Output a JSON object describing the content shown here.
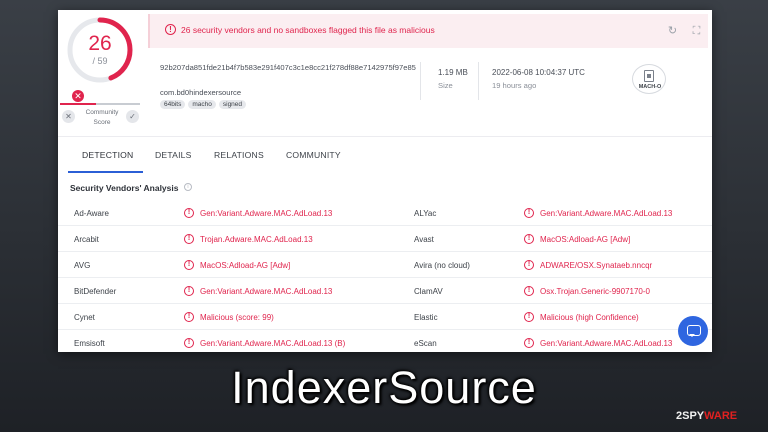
{
  "score": {
    "detected": "26",
    "total": "/ 59",
    "fraction": 0.44
  },
  "community": {
    "label_line1": "Community",
    "label_line2": "Score",
    "x_icon": "close-icon",
    "fill": 0.45
  },
  "alert": {
    "text": "26 security vendors and no sandboxes flagged this file as malicious",
    "color": "#e0244d"
  },
  "file": {
    "hash": "92b207da851fde21b4f7b583e291f407c3c1e8cc21f278df88e7142975f97e85",
    "name": "com.bd0hindexersource",
    "tags": [
      "64bits",
      "macho",
      "signed"
    ],
    "size": "1.19 MB",
    "size_label": "Size",
    "date": "2022-06-08 10:04:37 UTC",
    "date_ago": "19 hours ago",
    "type_label": "MACH-O"
  },
  "tabs": [
    "DETECTION",
    "DETAILS",
    "RELATIONS",
    "COMMUNITY"
  ],
  "section_title": "Security Vendors' Analysis",
  "vendors": [
    {
      "left_name": "Ad-Aware",
      "left_result": "Gen:Variant.Adware.MAC.AdLoad.13",
      "right_name": "ALYac",
      "right_result": "Gen:Variant.Adware.MAC.AdLoad.13"
    },
    {
      "left_name": "Arcabit",
      "left_result": "Trojan.Adware.MAC.AdLoad.13",
      "right_name": "Avast",
      "right_result": "MacOS:Adload-AG [Adw]"
    },
    {
      "left_name": "AVG",
      "left_result": "MacOS:Adload-AG [Adw]",
      "right_name": "Avira (no cloud)",
      "right_result": "ADWARE/OSX.Synataeb.nncqr"
    },
    {
      "left_name": "BitDefender",
      "left_result": "Gen:Variant.Adware.MAC.AdLoad.13",
      "right_name": "ClamAV",
      "right_result": "Osx.Trojan.Generic-9907170-0"
    },
    {
      "left_name": "Cynet",
      "left_result": "Malicious (score: 99)",
      "right_name": "Elastic",
      "right_result": "Malicious (high Confidence)"
    },
    {
      "left_name": "Emsisoft",
      "left_result": "Gen:Variant.Adware.MAC.AdLoad.13 (B)",
      "right_name": "eScan",
      "right_result": "Gen:Variant.Adware.MAC.AdLoad.13"
    }
  ],
  "caption": "IndexerSource",
  "watermark": {
    "part1": "2SPY",
    "part2": "WARE"
  },
  "colors": {
    "accent": "#2b5fd6",
    "danger": "#e0244d",
    "chat": "#2f66e0"
  }
}
